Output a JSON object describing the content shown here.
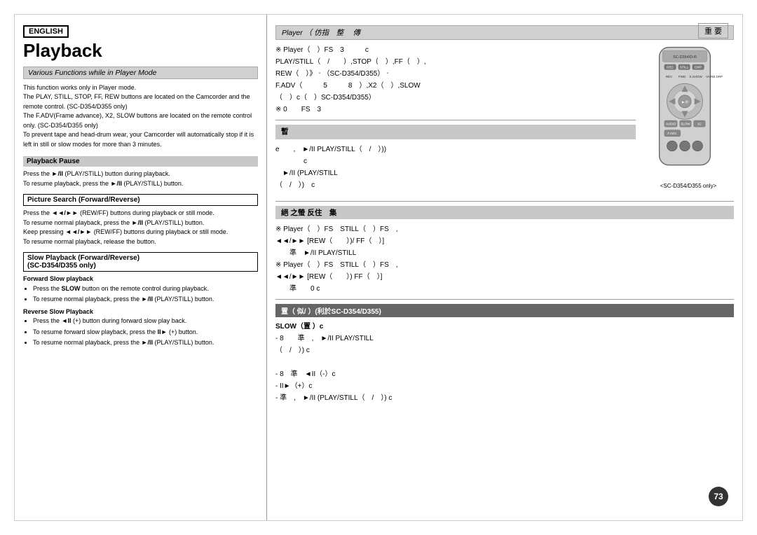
{
  "page": {
    "number": "73",
    "language_badge": "ENGLISH",
    "title": "Playback",
    "section_header": "Various Functions while in Player Mode",
    "intro": [
      "This function works only in Player mode.",
      "The PLAY, STILL, STOP, FF, REW buttons are located on the Camcorder and the remote control. (SC-D354/D355 only)",
      "The F.ADV(Frame advance), X2, SLOW buttons are located on the remote control only. (SC-D354/D355 only)",
      "To prevent tape and head-drum wear, your Camcorder will automatically stop if it is left in still or slow modes for more than 3 minutes."
    ],
    "playback_pause": {
      "title": "Playback Pause",
      "text": [
        "Press the ►/II (PLAY/STILL) button during playback.",
        "To resume playback, press the ►/II (PLAY/STILL) button."
      ]
    },
    "picture_search": {
      "title": "Picture Search (Forward/Reverse)",
      "text": [
        "Press the ◄◄/►► (REW/FF) buttons during playback or still mode.",
        "To resume normal playback, press the ►/II (PLAY/STILL) button.",
        "Keep pressing ◄◄/►► (REW/FF) buttons during playback or still mode.",
        "To resume normal playback, release the button."
      ]
    },
    "slow_playback": {
      "title": "Slow Playback (Forward/Reverse)",
      "subtitle": "(SC-D354/D355 only)",
      "forward": {
        "label": "Forward Slow playback",
        "items": [
          "Press the SLOW button on the remote control during playback.",
          "To resume normal playback, press the ►/II (PLAY/STILL) button."
        ]
      },
      "reverse": {
        "label": "Reverse Slow Playback",
        "items": [
          "Press the ◄II (+) button during forward slow play back.",
          "To resume forward slow playback, press the II► (+) button.",
          "To resume normal playback, press the ►/II (PLAY/STILL) button."
        ]
      }
    },
    "right_panel": {
      "chinese_top_label": "重 要",
      "player_header": "Player （ 仿指　整　 傳",
      "chinese_intro": "※ Player（  ）FS  3     c\nPLAY/STILL（  /    ）,STOP（  ）,FF（   ）,\nREW（  ）》,-(SC-D354/D355）ㆍ\nF.ADV（     5     8  ）,X2（   ）,SLOW\n（   ）c（  ）SC-D354/D355）\n※ 0   FS  3",
      "pause_section": {
        "header": "暫",
        "text": "e   ,  ►/II (PLAY/STILL（  /   ）)\n         c\n  ►/II (PLAY/STILL\n（  /   ）)  c"
      },
      "search_section": {
        "header": "絕 之螢 反住　集",
        "text": "※ Player（  ）FS  STILL（   ）FS  ,\n◄◄/►► [REW（   ）)/ FF（  ）]\n준  ►/II PLAY/STILL\n※ Player（  ）FS  STILL（  ）FS  ,\n◄◄/►► [REW（   ）) FF（  ）]\n준    0 c"
      },
      "slow_section": {
        "header": "置（ 似/ ）(利於SC-D354/D355)",
        "forward_label": "SLOW（置 ）c",
        "forward_text": "- 8    準  ,  ►/II PLAY/STILL\n（  /  ）) c",
        "reverse_text": "- 8  準  ◄II（-）c\n- II►（+）c\n- 準  , ►/II (PLAY/STILL（  /  ）) c"
      },
      "remote_caption": "<SC-D354/D355 only>"
    }
  }
}
